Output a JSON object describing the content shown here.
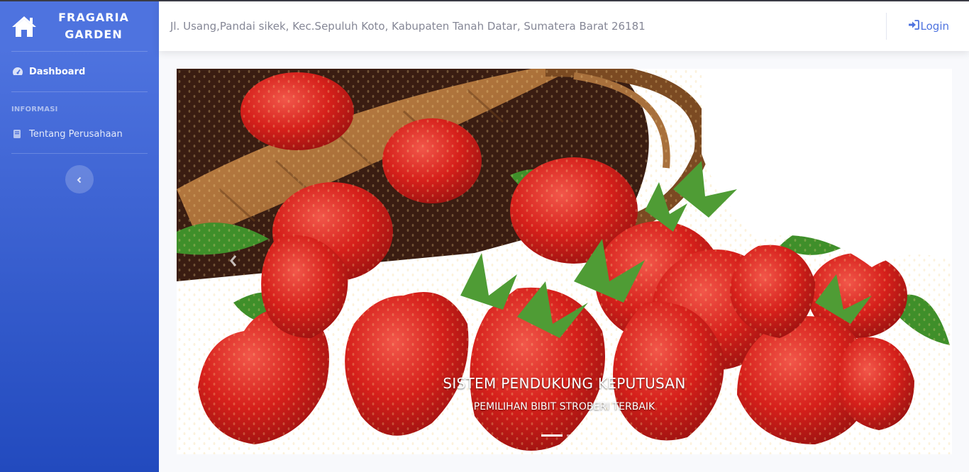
{
  "brand": {
    "line1": "FRAGARIA",
    "line2": "GARDEN",
    "icon": "home-icon"
  },
  "sidebar": {
    "dashboard": {
      "label": "Dashboard",
      "icon": "tachometer-icon"
    },
    "heading_info": "INFORMASI",
    "about": {
      "label": "Tentang Perusahaan",
      "icon": "book-icon"
    },
    "toggle_icon": "chevron-left-icon"
  },
  "topbar": {
    "address": "Jl. Usang,Pandai sikek, Kec.Sepuluh Koto, Kabupaten Tanah Datar, Sumatera Barat 26181",
    "login_label": "Login",
    "login_icon": "sign-in-icon"
  },
  "carousel": {
    "title": "SISTEM PENDUKUNG KEPUTUSAN",
    "subtitle": "PEMILIHAN BIBIT STROBERI TERBAIK",
    "slides": 2,
    "active_slide": 1,
    "prev_icon": "chevron-left-icon"
  },
  "colors": {
    "primary": "#4e73df",
    "primary_dark": "#224abe",
    "muted": "#858796",
    "background": "#f8f9fc"
  }
}
